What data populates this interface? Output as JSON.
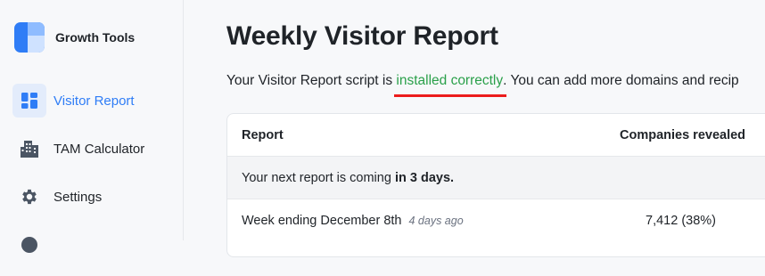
{
  "app": {
    "name": "Growth Tools"
  },
  "sidebar": {
    "items": [
      {
        "label": "Visitor Report",
        "icon": "dashboard-icon",
        "active": true
      },
      {
        "label": "TAM Calculator",
        "icon": "buildings-icon",
        "active": false
      },
      {
        "label": "Settings",
        "icon": "gear-icon",
        "active": false
      }
    ]
  },
  "main": {
    "title": "Weekly Visitor Report",
    "status_prefix": "Your Visitor Report script is ",
    "status_highlight": "installed correctly",
    "status_suffix": ". You can add more domains and recip",
    "table": {
      "headers": [
        "Report",
        "Companies revealed"
      ],
      "next_report_prefix": "Your next report is coming ",
      "next_report_bold": "in 3 days.",
      "rows": [
        {
          "week": "Week ending December 8th",
          "ago": "4 days ago",
          "companies": "7,412 (38%)"
        }
      ]
    }
  },
  "colors": {
    "accent": "#2f7df6",
    "success": "#2aa04a",
    "underline": "#ec1c1c"
  }
}
